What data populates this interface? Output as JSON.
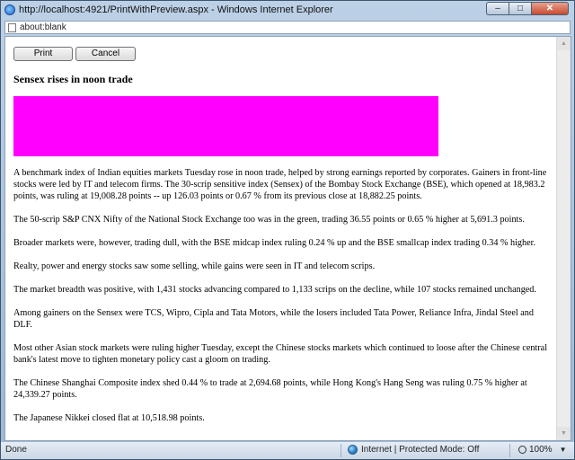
{
  "window": {
    "title": "http://localhost:4921/PrintWithPreview.aspx - Windows Internet Explorer",
    "controls": {
      "minimize": "–",
      "maximize": "□",
      "close": "✕"
    }
  },
  "address": {
    "value": "about:blank"
  },
  "page": {
    "buttons": {
      "print": "Print",
      "cancel": "Cancel"
    },
    "headline": "Sensex rises in noon trade",
    "image_color": "#ff00ff",
    "paragraphs": [
      "A benchmark index of Indian equities markets Tuesday rose in noon trade, helped by strong earnings reported by corporates. Gainers in front-line stocks were led by IT and telecom firms. The 30-scrip sensitive index (Sensex) of the Bombay Stock Exchange (BSE), which opened at 18,983.2 points, was ruling at 19,008.28 points -- up 126.03 points or 0.67 % from its previous close at 18,882.25 points.",
      "The 50-scrip S&P CNX Nifty of the National Stock Exchange too was in the green, trading 36.55 points or 0.65 % higher at 5,691.3 points.",
      "Broader markets were, however, trading dull, with the BSE midcap index ruling 0.24 % up and the BSE smallcap index trading 0.34 % higher.",
      "Realty, power and energy stocks saw some selling, while gains were seen in IT and telecom scrips.",
      "The market breadth was positive, with 1,431 stocks advancing compared to 1,133 scrips on the decline, while 107 stocks remained unchanged.",
      "Among gainers on the Sensex were TCS, Wipro, Cipla and Tata Motors, while the losers included Tata Power, Reliance Infra, Jindal Steel and DLF.",
      "Most other Asian stock markets were ruling higher Tuesday, except the Chinese stocks markets which continued to loose after the Chinese central bank's latest move to tighten monetary policy cast a gloom on trading.",
      "The Chinese Shanghai Composite index shed 0.44 % to trade at 2,694.68 points, while Hong Kong's Hang Seng was ruling 0.75 % higher at 24,339.27 points.",
      "The Japanese Nikkei closed flat at 10,518.98 points."
    ]
  },
  "status": {
    "text": "Done",
    "zone": "Internet | Protected Mode: Off",
    "zoom": "100%",
    "zoom_caret": "▼"
  },
  "scrollbar": {
    "up": "▲",
    "down": "▼"
  }
}
